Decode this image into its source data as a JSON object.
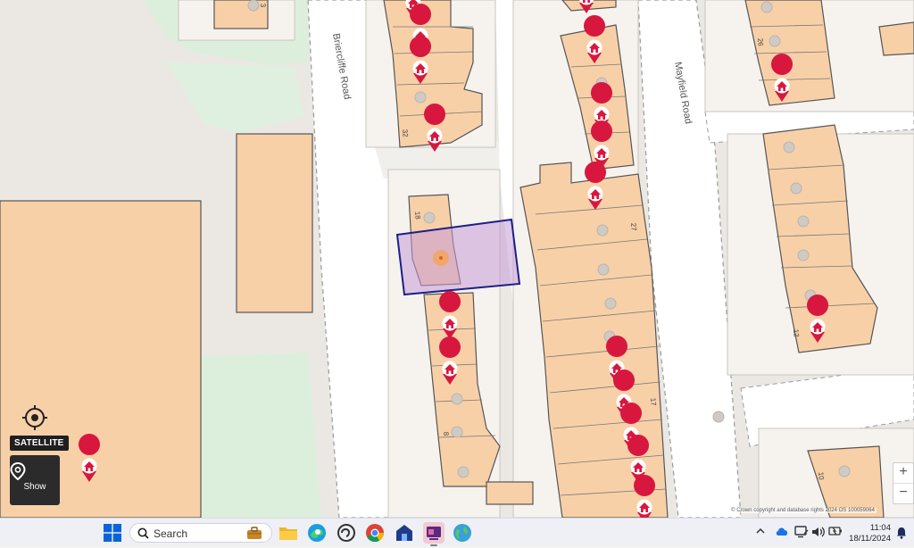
{
  "map": {
    "roads": [
      "Briercliffe Road",
      "Mayfield Road"
    ],
    "house_numbers": [
      "32",
      "18",
      "8",
      "27",
      "17",
      "26",
      "12",
      "10",
      "3"
    ],
    "colors": {
      "background": "#e9e6e2",
      "road": "#ffffff",
      "plot": "#f6f3ef",
      "building": "#f8d0a8",
      "building_stroke": "#555555",
      "green": "#dcefdc",
      "selection_fill": "#c79bd6",
      "selection_stroke": "#1c1f8a",
      "marker": "#d8173f"
    },
    "controls": {
      "satellite_label": "SATELLITE",
      "show_label": "Show",
      "zoom_in": "+",
      "zoom_out": "−"
    },
    "copyright": "© Crown copyright and database rights 2024 OS 100059064"
  },
  "taskbar": {
    "search_placeholder": "Search",
    "time": "11:04",
    "date": "18/11/2024",
    "apps": [
      "file-explorer",
      "edge",
      "copilot",
      "chrome",
      "store",
      "active-app",
      "widgets"
    ]
  }
}
